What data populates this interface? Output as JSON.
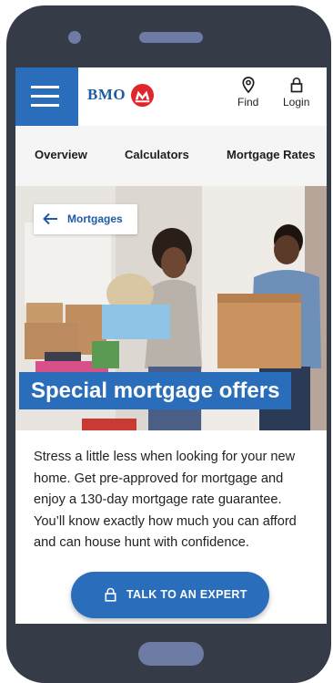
{
  "header": {
    "brand": "BMO",
    "find_label": "Find",
    "login_label": "Login"
  },
  "tabs": [
    {
      "label": "Overview"
    },
    {
      "label": "Calculators"
    },
    {
      "label": "Mortgage Rates"
    }
  ],
  "hero": {
    "back_label": "Mortgages",
    "title": "Special mortgage offers"
  },
  "body": {
    "text": "Stress a little less when looking for your new home. Get pre-approved for mortgage and enjoy a 130-day mortgage rate guarantee. You’ll know exactly how much you can afford and can house hunt with confidence."
  },
  "cta": {
    "label": "TALK TO AN EXPERT"
  },
  "colors": {
    "brand_blue": "#2a6ebb",
    "brand_red": "#e2242d",
    "device_frame": "#363b48"
  }
}
